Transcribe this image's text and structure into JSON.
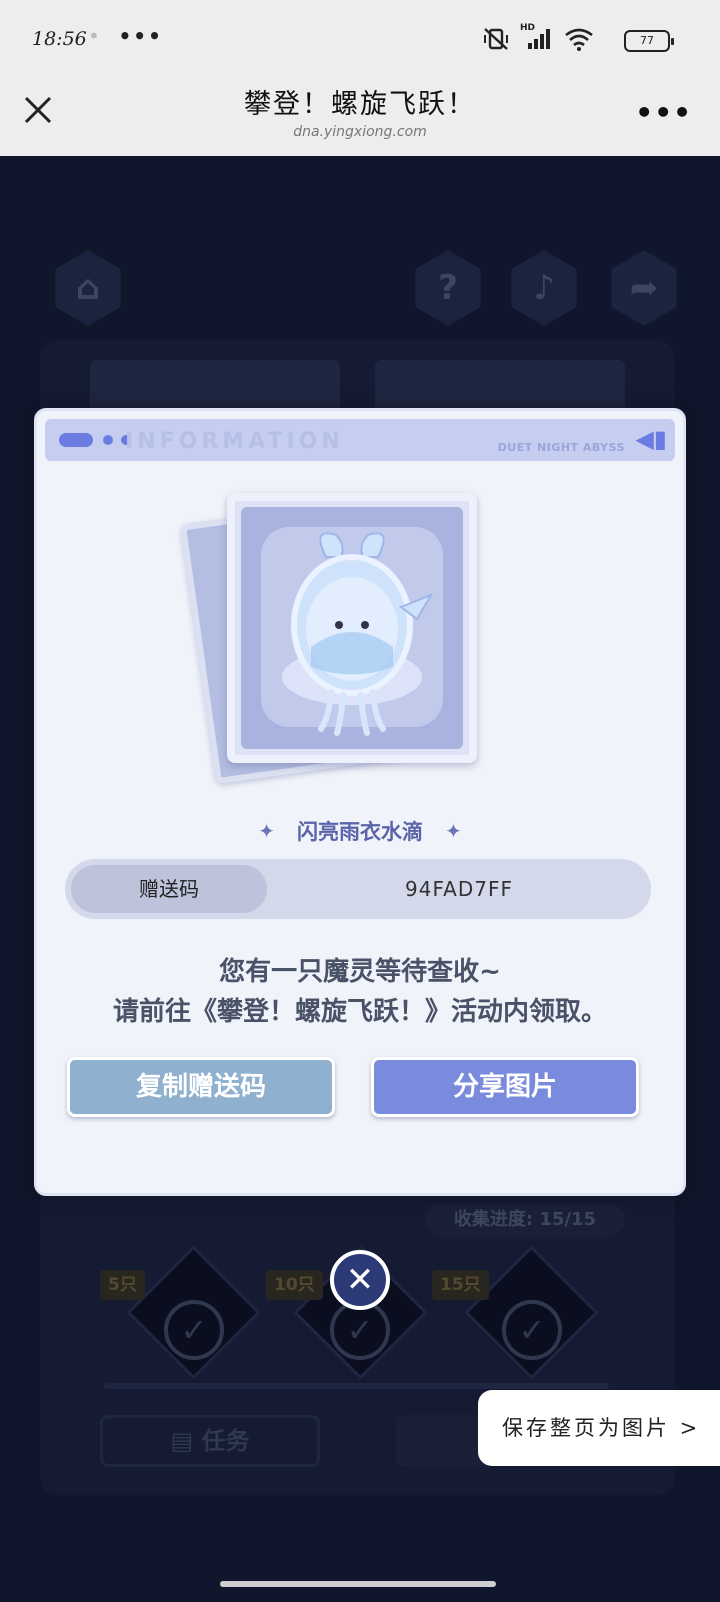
{
  "status_bar": {
    "time": "18:56",
    "more": "•••",
    "network": "HD",
    "battery": "77"
  },
  "title_bar": {
    "title": "攀登！螺旋飞跃！",
    "url": "dna.yingxiong.com"
  },
  "background": {
    "top_icons": [
      "home-icon",
      "help-icon",
      "music-icon",
      "share-icon"
    ],
    "progress_label": "收集进度: 15/15",
    "milestones": [
      "5只",
      "10只",
      "15只"
    ],
    "task_button": "任务"
  },
  "modal": {
    "header_ghost": "INFORMATION",
    "header_brand": "DUET NIGHT ABYSS",
    "item_name": "闪亮雨衣水滴",
    "code_label": "赠送码",
    "code_value": "94FAD7FF",
    "message_line1": "您有一只魔灵等待查收~",
    "message_line2": "请前往《攀登！螺旋飞跃！》活动内领取。",
    "copy_button": "复制赠送码",
    "share_button": "分享图片"
  },
  "save_page": "保存整页为图片 >",
  "colors": {
    "accent": "#7a8bdd",
    "copy_button": "#8fb0cf",
    "modal_bg": "#f0f3fa",
    "page_bg": "#141c33"
  }
}
